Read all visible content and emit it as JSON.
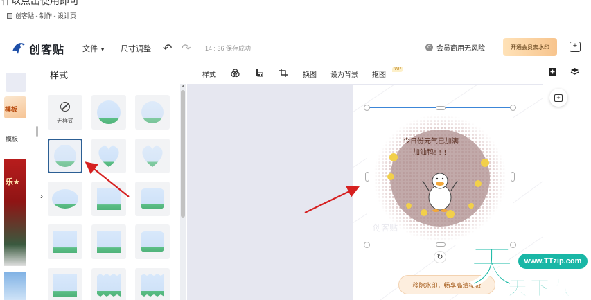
{
  "top_caption_cut": "件以点出使用即可",
  "caption": "创客贴 - 制作 - 设计页",
  "header": {
    "logo_text": "创客贴",
    "menu_file": "文件",
    "menu_resize": "尺寸调整",
    "save_status": "14 : 36 保存成功",
    "vip_risk_badge": "C",
    "vip_risk_label": "会员商用无风险",
    "member_button": "开通会员去水印"
  },
  "sidebar": {
    "template_badge": "模板",
    "template_label": "模板",
    "festival_text": "乐★"
  },
  "style_panel": {
    "title": "样式",
    "no_style_label": "无样式"
  },
  "toolbar": {
    "style": "样式",
    "replace": "换图",
    "set_bg": "设为背景",
    "cutout": "抠图",
    "vip_tag": "VIP"
  },
  "canvas": {
    "image_text_line1": "今日份元气已加满",
    "image_text_line2": "加油鸭! ! !",
    "watermark_text": "创客贴",
    "watermark_bar": "移除水印，畅享高清模板"
  },
  "site_badge": {
    "url": "www.TTzip.com",
    "big_char": "天",
    "name": "天下载"
  },
  "colors": {
    "accent_blue": "#3c86d8",
    "arrow_red": "#d62020",
    "site_teal": "#16b8a4"
  }
}
